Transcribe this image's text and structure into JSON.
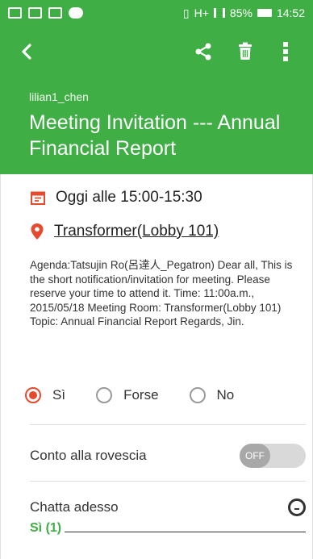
{
  "status_bar": {
    "battery_percent": "85%",
    "time": "14:52",
    "network": "H+"
  },
  "toolbar": {
    "back_icon": "back-arrow-icon",
    "share_icon": "share-icon",
    "delete_icon": "trash-icon",
    "menu_icon": "more-vert-icon"
  },
  "event": {
    "owner": "lilian1_chen",
    "title": "Meeting Invitation --- Annual Financial Report",
    "time": "Oggi alle 15:00-15:30",
    "location": "Transformer(Lobby 101)",
    "description": "Agenda:Tatsujin Ro(呂達人_Pegatron) Dear all, This is the short notification/invitation for meeting. Please reserve your time to attend it. Time: 11:00a.m., 2015/05/18 Meeting Room: Transformer(Lobby 101) Topic: Annual Financial Report Regards, Jin."
  },
  "rsvp": {
    "options": [
      "Sì",
      "Forse",
      "No"
    ],
    "selected": "Sì"
  },
  "settings": {
    "countdown_label": "Conto alla rovescia",
    "countdown_toggle": "OFF",
    "chat_label": "Chatta adesso"
  },
  "attendees": {
    "section_label": "Sì (1)"
  },
  "colors": {
    "accent": "#3fae44",
    "radio_selected": "#e64a2e"
  }
}
